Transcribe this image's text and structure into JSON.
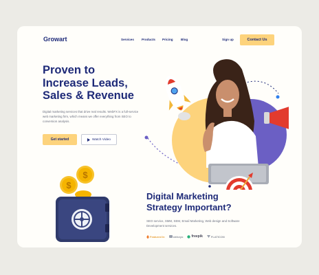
{
  "nav": {
    "logo": "Growart",
    "links": [
      "Services",
      "Products",
      "Pricing",
      "Blog"
    ],
    "signup": "Sign up",
    "contact": "Contact Us"
  },
  "hero": {
    "headline_1": "Proven to",
    "headline_2": "Increase Leads,",
    "headline_3": "Sales & Revenue",
    "description": "Digital marketing services that drive real results. WebFX is a full-service web marketing firm, which means we offer everything from SEO to conversion analysis.",
    "get_started": "Get started",
    "watch_video": "Watch Video"
  },
  "section2": {
    "title_1": "Digital Marketing",
    "title_2": "Strategy Important?",
    "description": "SEO service, SMM, SEM, Email Marketing, Web design and Software Development services.",
    "featured_label": "Featured In",
    "brands": [
      "shikeyo",
      "freepik",
      "FLATICON"
    ]
  },
  "colors": {
    "navy": "#1e2a78",
    "yellow": "#fdd37c",
    "purple": "#6b5fc4",
    "card": "#fffefa",
    "background": "#ecebe6"
  },
  "icons": [
    "rocket-icon",
    "megaphone-icon",
    "target-icon",
    "coin-icon",
    "vault-icon",
    "play-icon",
    "fire-icon"
  ]
}
